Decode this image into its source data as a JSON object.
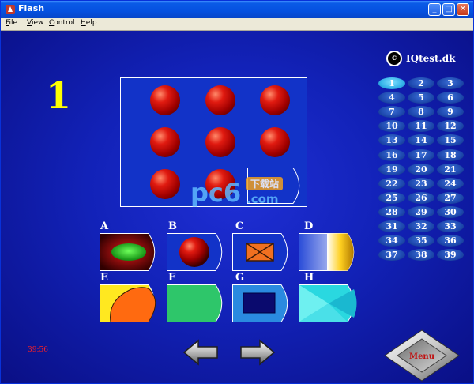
{
  "window": {
    "title": "Flash",
    "minimize_icon": "minimize-icon",
    "maximize_icon": "maximize-icon",
    "close_icon": "close-icon"
  },
  "menubar": {
    "items": [
      {
        "label": "File",
        "accel": "F",
        "rest": "ile"
      },
      {
        "label": "View",
        "accel": "V",
        "rest": "iew"
      },
      {
        "label": "Control",
        "accel": "C",
        "rest": "ontrol"
      },
      {
        "label": "Help",
        "accel": "H",
        "rest": "elp"
      }
    ]
  },
  "game": {
    "question_number": "1",
    "logo_mark": "c",
    "logo_text": "IQtest.dk",
    "timer": "39:56",
    "menu_label": "Menu",
    "puzzle": {
      "rows": 3,
      "cols": 3,
      "cell": "red-sphere",
      "missing_cell": "3-3"
    },
    "question_buttons": [
      "1",
      "2",
      "3",
      "4",
      "5",
      "6",
      "7",
      "8",
      "9",
      "10",
      "11",
      "12",
      "13",
      "14",
      "15",
      "16",
      "17",
      "18",
      "19",
      "20",
      "21",
      "22",
      "23",
      "24",
      "25",
      "26",
      "27",
      "28",
      "29",
      "30",
      "31",
      "32",
      "33",
      "34",
      "35",
      "36",
      "37",
      "38",
      "39"
    ],
    "active_question": "1",
    "options": [
      {
        "letter": "A",
        "content": "green-ellipse-on-dark-red"
      },
      {
        "letter": "B",
        "content": "red-sphere"
      },
      {
        "letter": "C",
        "content": "orange-envelope"
      },
      {
        "letter": "D",
        "content": "blue-white-yellow-gradient"
      },
      {
        "letter": "E",
        "content": "orange-shape-on-yellow"
      },
      {
        "letter": "F",
        "content": "green-tile"
      },
      {
        "letter": "G",
        "content": "dark-navy-rectangle"
      },
      {
        "letter": "H",
        "content": "cyan-triangles"
      }
    ]
  },
  "watermark": {
    "brand": "pc6",
    "tag": "下载站",
    "domain": ".com"
  },
  "colors": {
    "background": "#1222b8",
    "question_number": "#ffff00",
    "timer": "#ff2020",
    "active_question": "#33b2e8"
  }
}
